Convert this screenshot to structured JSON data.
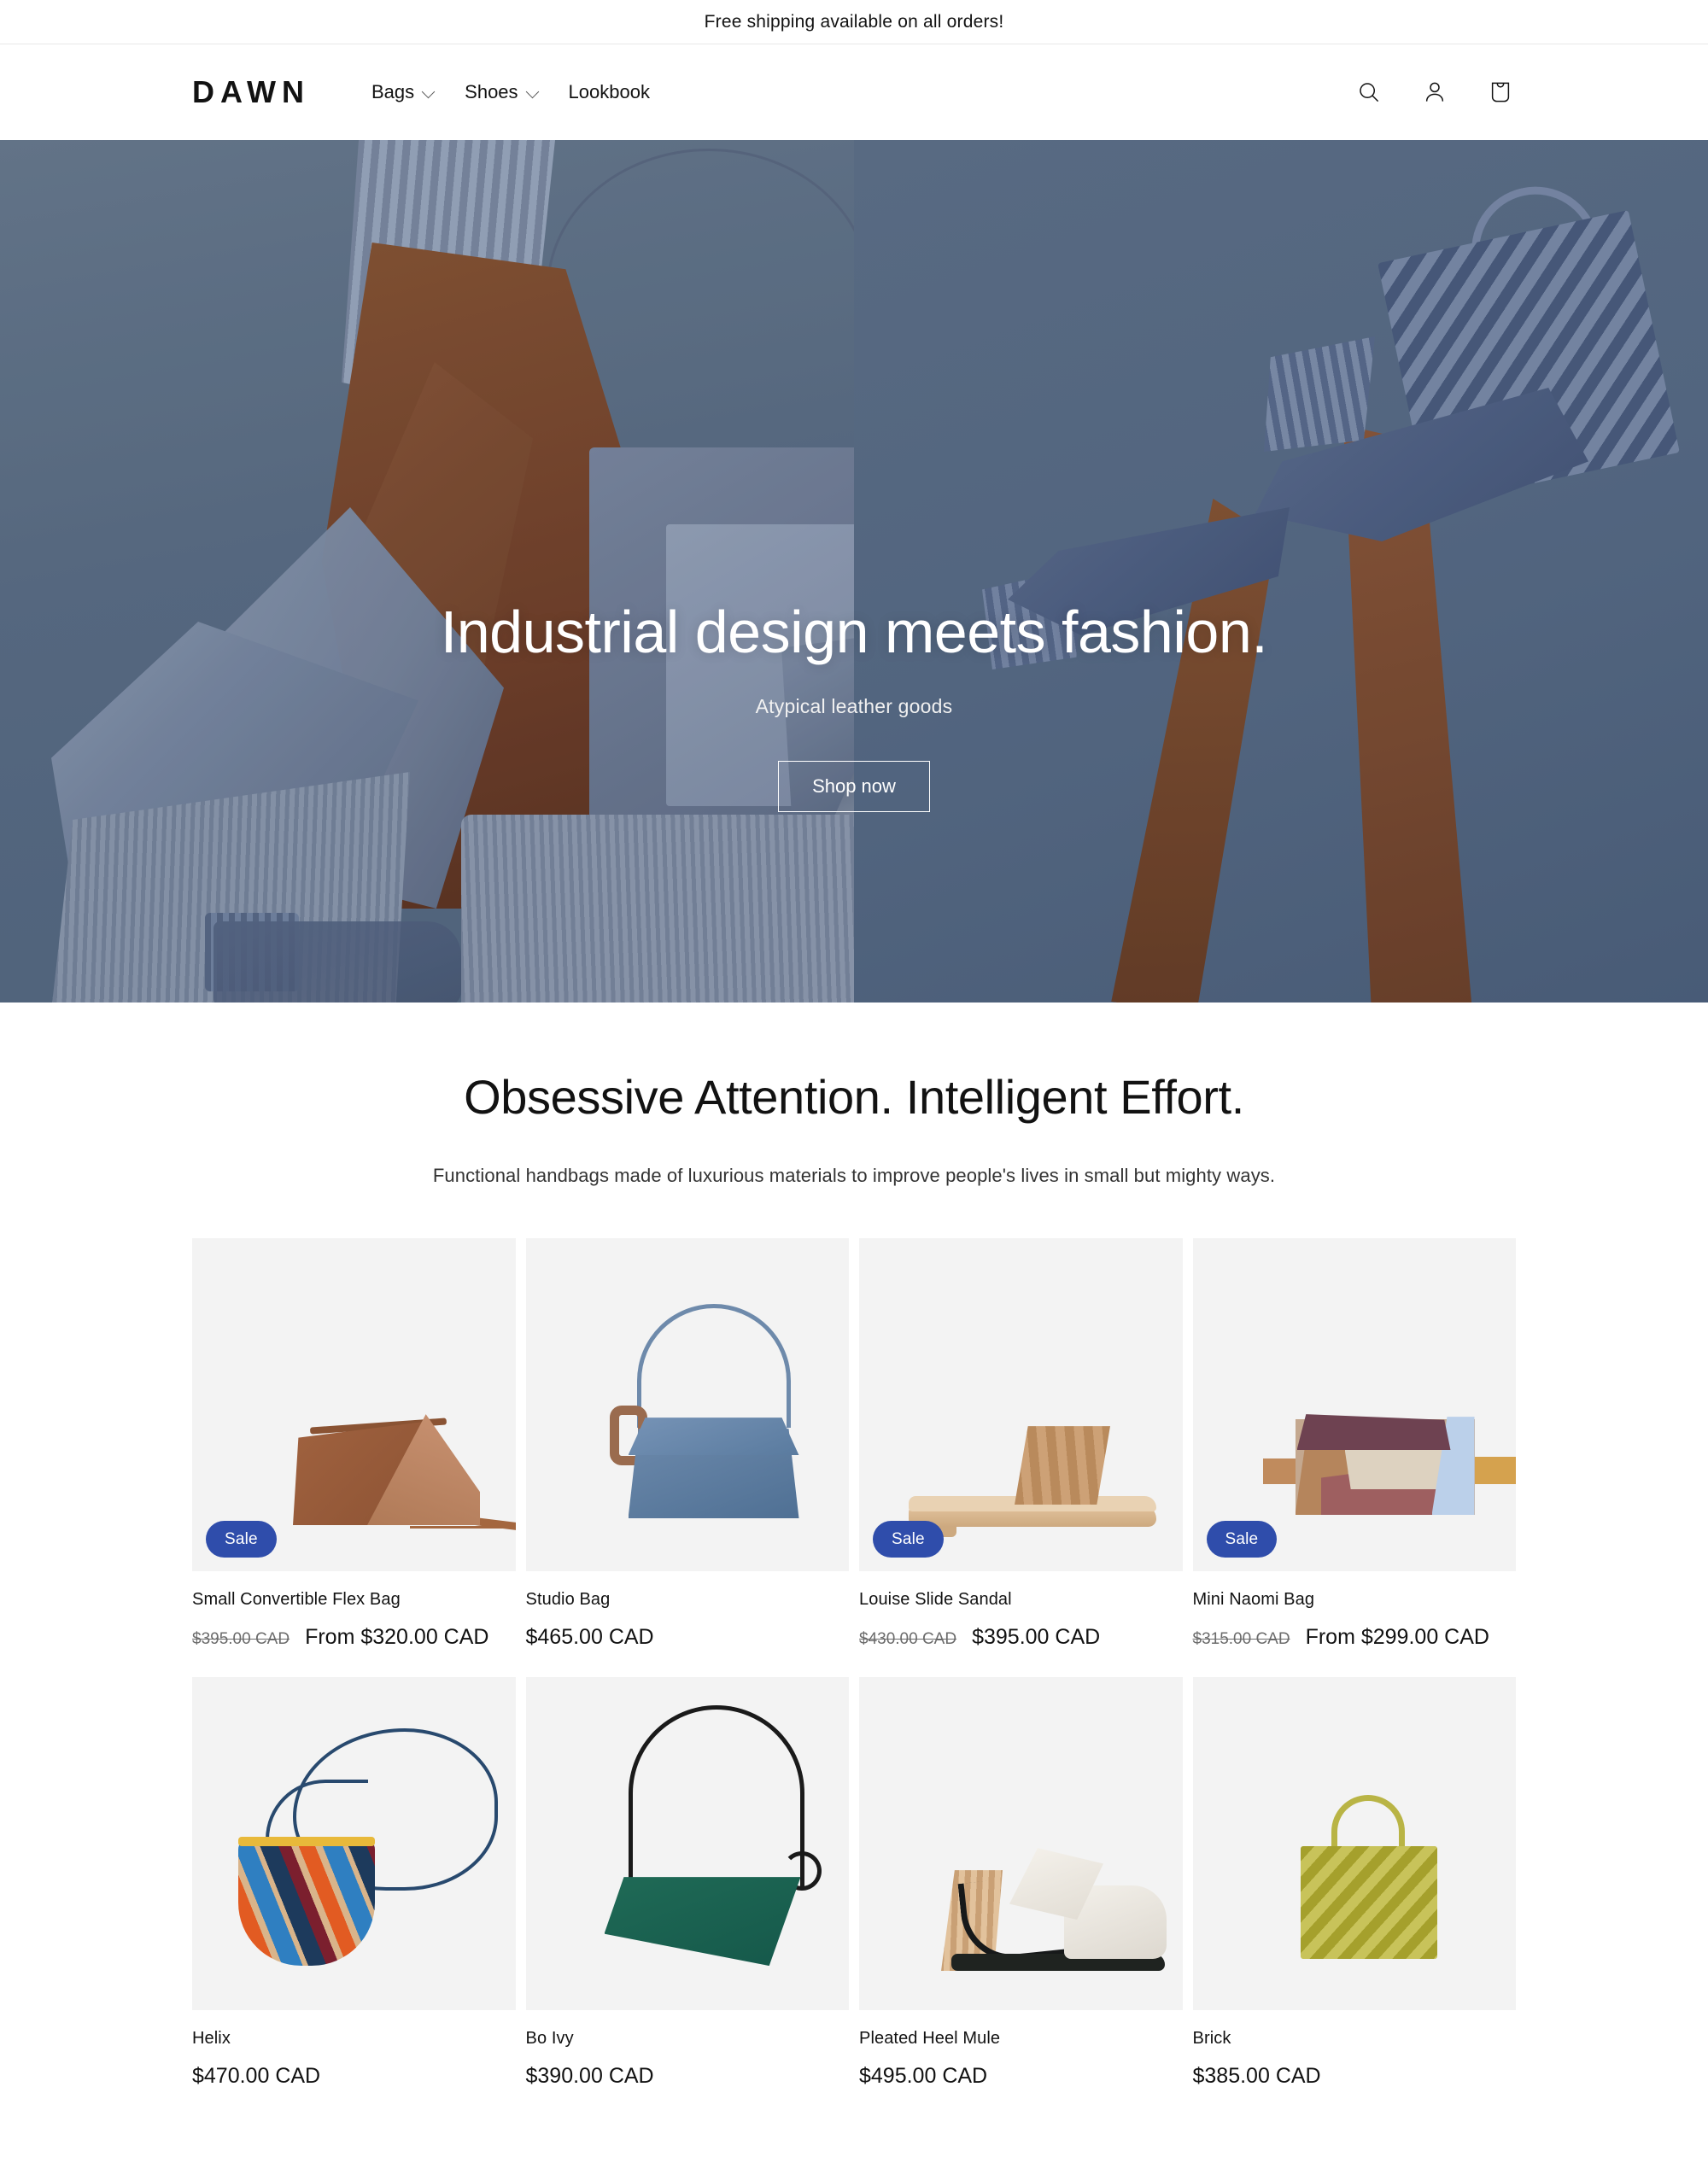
{
  "announcement": {
    "text": "Free shipping available on all orders!"
  },
  "header": {
    "logo": "DAWN",
    "nav": [
      {
        "label": "Bags",
        "has_dropdown": true
      },
      {
        "label": "Shoes",
        "has_dropdown": true
      },
      {
        "label": "Lookbook",
        "has_dropdown": false
      }
    ],
    "actions": [
      {
        "name": "search-icon",
        "label": "Search"
      },
      {
        "name": "account-icon",
        "label": "Log in"
      },
      {
        "name": "cart-icon",
        "label": "Cart"
      }
    ]
  },
  "hero": {
    "title": "Industrial design meets fashion.",
    "subtitle": "Atypical leather goods",
    "button": "Shop now"
  },
  "rich_text": {
    "heading": "Obsessive Attention. Intelligent Effort.",
    "body": "Functional handbags made of luxurious materials to improve people's lives in small but mighty ways."
  },
  "colors": {
    "sale_badge": "#2F4DAB",
    "card_background": "#F3F3F3",
    "text": "#121212"
  },
  "products": [
    {
      "title": "Small Convertible Flex Bag",
      "badge": "Sale",
      "price_old": "$395.00 CAD",
      "price": "From $320.00 CAD"
    },
    {
      "title": "Studio Bag",
      "badge": null,
      "price_old": null,
      "price": "$465.00 CAD"
    },
    {
      "title": "Louise Slide Sandal",
      "badge": "Sale",
      "price_old": "$430.00 CAD",
      "price": "$395.00 CAD"
    },
    {
      "title": "Mini Naomi Bag",
      "badge": "Sale",
      "price_old": "$315.00 CAD",
      "price": "From $299.00 CAD"
    },
    {
      "title": "Helix",
      "badge": null,
      "price_old": null,
      "price": "$470.00 CAD"
    },
    {
      "title": "Bo Ivy",
      "badge": null,
      "price_old": null,
      "price": "$390.00 CAD"
    },
    {
      "title": "Pleated Heel Mule",
      "badge": null,
      "price_old": null,
      "price": "$495.00 CAD"
    },
    {
      "title": "Brick",
      "badge": null,
      "price_old": null,
      "price": "$385.00 CAD"
    }
  ]
}
